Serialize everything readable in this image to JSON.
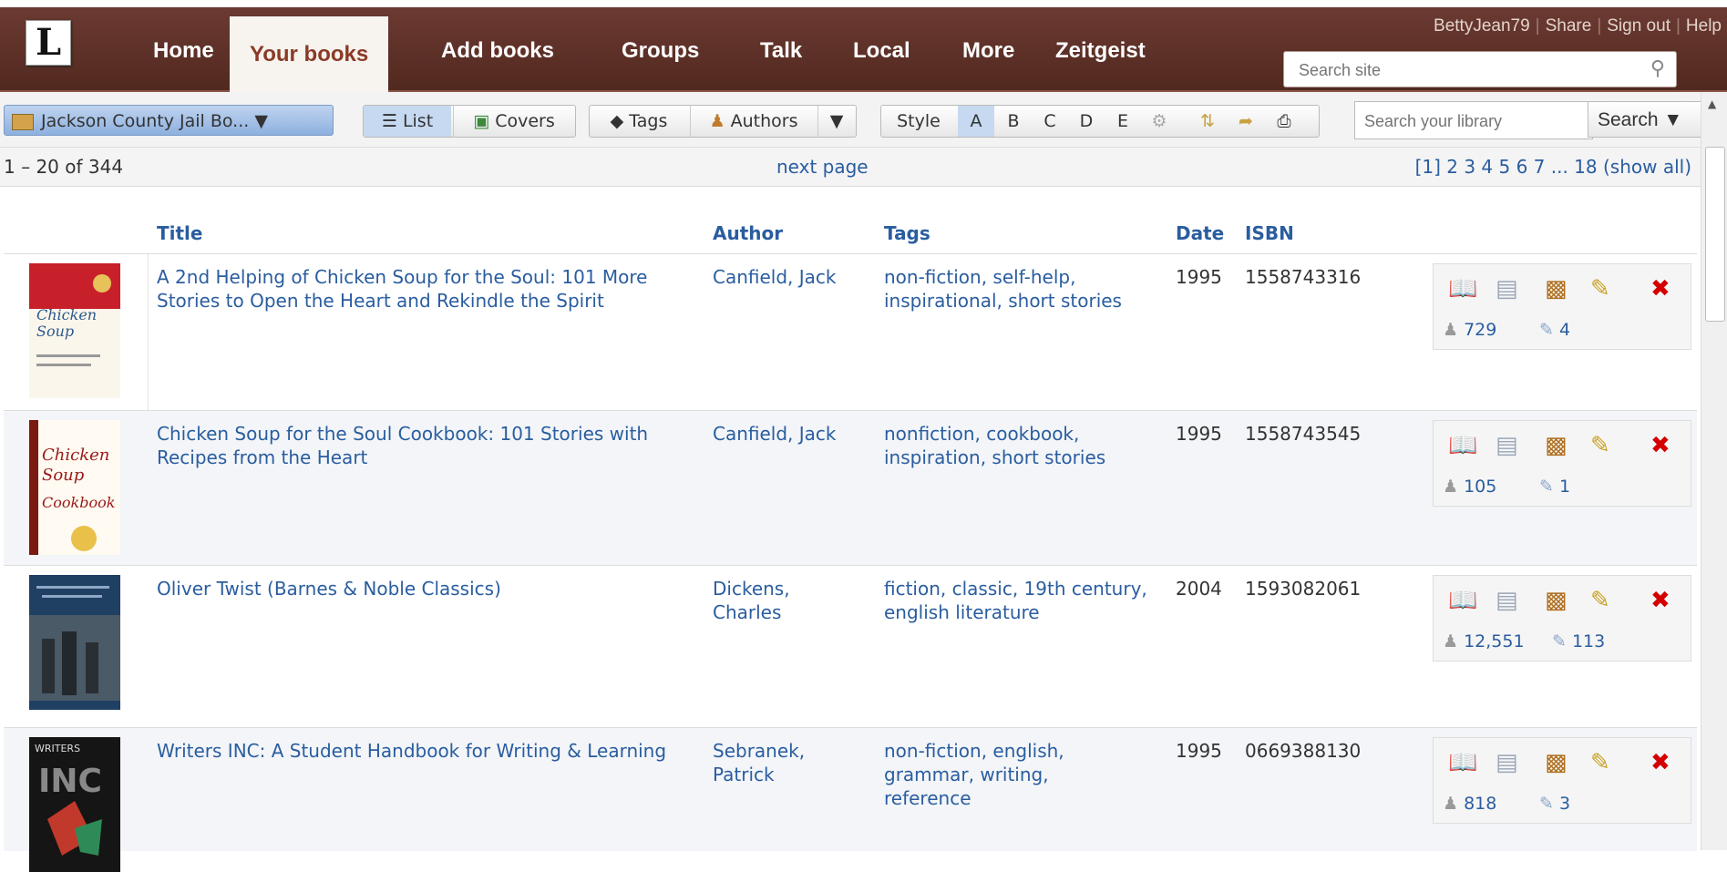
{
  "nav": {
    "logo": "L",
    "tabs": [
      "Home",
      "Your books",
      "Add books",
      "Groups",
      "Talk",
      "Local",
      "More",
      "Zeitgeist"
    ],
    "user": "BettyJean79",
    "share": "Share",
    "signout": "Sign out",
    "help": "Help",
    "search_placeholder": "Search site"
  },
  "toolbar": {
    "collection": "Jackson County Jail Bo...",
    "list": "List",
    "covers": "Covers",
    "tags": "Tags",
    "authors": "Authors",
    "style": "Style",
    "styles": [
      "A",
      "B",
      "C",
      "D",
      "E"
    ],
    "search_placeholder": "Search your library",
    "search_button": "Search"
  },
  "pager": {
    "count": "1 – 20 of 344",
    "next": "next page",
    "pages": "[1] 2 3 4 5 6 7 ... 18 (show all)"
  },
  "columns": {
    "title": "Title",
    "author": "Author",
    "tags": "Tags",
    "date": "Date",
    "isbn": "ISBN"
  },
  "books": [
    {
      "title": "A 2nd Helping of Chicken Soup for the Soul: 101 More Stories to Open the Heart and Rekindle the Spirit",
      "author": "Canfield, Jack",
      "tags": "non-fiction, self-help, inspirational, short stories",
      "date": "1995",
      "isbn": "1558743316",
      "members": "729",
      "reviews": "4"
    },
    {
      "title": "Chicken Soup for the Soul Cookbook: 101 Stories with Recipes from the Heart",
      "author": "Canfield, Jack",
      "tags": "nonfiction, cookbook, inspiration, short stories",
      "date": "1995",
      "isbn": "1558743545",
      "members": "105",
      "reviews": "1"
    },
    {
      "title": "Oliver Twist (Barnes & Noble Classics)",
      "author": "Dickens, Charles",
      "tags": "fiction, classic, 19th century, english literature",
      "date": "2004",
      "isbn": "1593082061",
      "members": "12,551",
      "reviews": "113"
    },
    {
      "title": "Writers INC: A Student Handbook for Writing & Learning",
      "author": "Sebranek, Patrick",
      "tags": "non-fiction, english, grammar, writing, reference",
      "date": "1995",
      "isbn": "0669388130",
      "members": "818",
      "reviews": "3"
    }
  ],
  "colors": {
    "nav_bg": "#5b2f27",
    "active_tab": "#8a3a26",
    "link": "#2a5d9f",
    "delete": "#d40000"
  }
}
